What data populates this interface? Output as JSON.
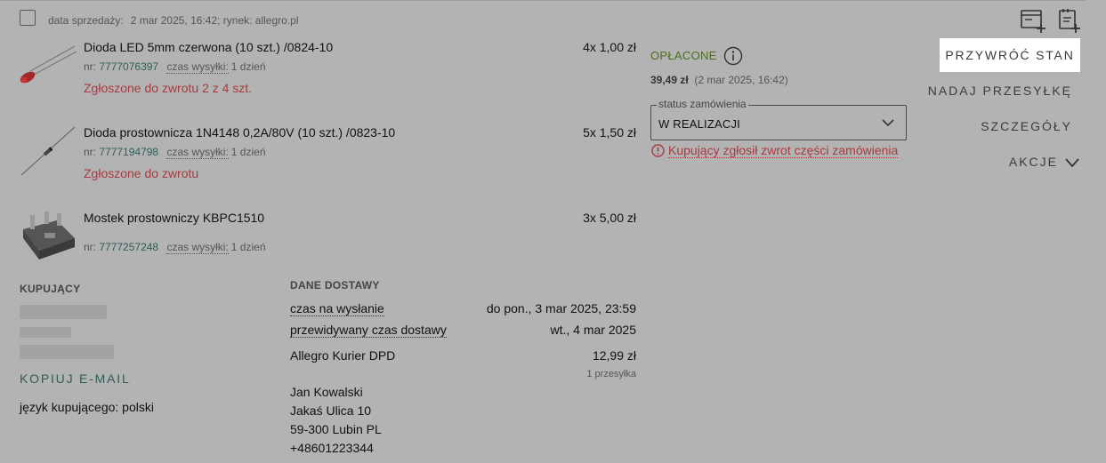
{
  "sale": {
    "label": "data sprzedaży:",
    "value": "2 mar 2025, 16:42; rynek: allegro.pl"
  },
  "items": [
    {
      "title": "Dioda LED 5mm czerwona (10 szt.) /0824-10",
      "nr_label": "nr:",
      "nr": "7777076397",
      "ship_label": "czas wysyłki:",
      "ship_value": "1 dzień",
      "status": "Zgłoszone do zwrotu 2 z 4 szt.",
      "qty": "4x 1,00 zł"
    },
    {
      "title": "Dioda prostownicza 1N4148 0,2A/80V (10 szt.) /0823-10",
      "nr_label": "nr:",
      "nr": "7777194798",
      "ship_label": "czas wysyłki:",
      "ship_value": "1 dzień",
      "status": "Zgłoszone do zwrotu",
      "qty": "5x 1,50 zł"
    },
    {
      "title": "Mostek prostowniczy KBPC1510",
      "nr_label": "nr:",
      "nr": "7777257248",
      "ship_label": "czas wysyłki:",
      "ship_value": "1 dzień",
      "status": "",
      "qty": "3x 5,00 zł"
    }
  ],
  "payment": {
    "status": "OPŁACONE",
    "amount": "39,49 zł",
    "date": "(2 mar 2025, 16:42)"
  },
  "order_status": {
    "legend": "status zamówienia",
    "value": "W REALIZACJI",
    "warning": "Kupujący zgłosił zwrot części zamówienia"
  },
  "actions": {
    "restore": "PRZYWRÓĆ STAN",
    "send": "NADAJ PRZESYŁKĘ",
    "details": "SZCZEGÓŁY",
    "more": "AKCJE"
  },
  "buyer": {
    "title": "KUPUJĄCY",
    "copy_email": "KOPIUJ E-MAIL",
    "language": "język kupującego: polski"
  },
  "delivery": {
    "title": "DANE DOSTAWY",
    "send_label": "czas na wysłanie",
    "send_value": "do pon., 3 mar 2025, 23:59",
    "expected_label": "przewidywany czas dostawy",
    "expected_value": "wt., 4 mar 2025",
    "carrier": "Allegro Kurier DPD",
    "price": "12,99 zł",
    "parcels": "1 przesyłka",
    "address": [
      "Jan Kowalski",
      "Jakaś Ulica 10",
      "59-300 Lubin PL",
      "+48601223344"
    ]
  }
}
